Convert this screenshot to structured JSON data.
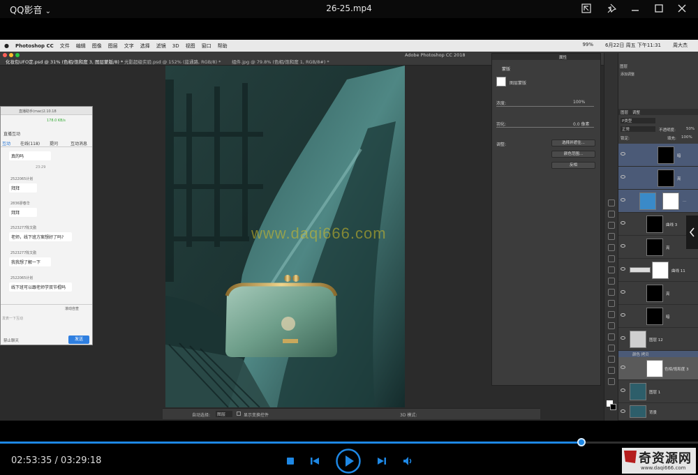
{
  "player": {
    "app_name": "QQ影音",
    "file_title": "26-25.mp4",
    "time_current": "02:53:35",
    "time_separator": " / ",
    "time_total": "03:29:18",
    "progress": 0.833,
    "accent": "#1e88e5"
  },
  "mac_menubar": {
    "items": [
      "Photoshop CC",
      "文件",
      "编辑",
      "图像",
      "图层",
      "文字",
      "选择",
      "滤镜",
      "3D",
      "视图",
      "窗口",
      "帮助"
    ],
    "battery": "99%",
    "date_time": "6月22日 周五 下午11:31",
    "user": "周大杰"
  },
  "ps": {
    "doc_title": "Adobe Photoshop CC 2018",
    "tabs": [
      "化妆包UFO定.psd @ 31% (色相/饱和度 3, 图层蒙版/8) *",
      "光影超级实验.psd @ 152% (蓝通路, RGB/8) *",
      "组件.jpg @ 79.8% (色相/饱和度 1, RGB/8#) *"
    ],
    "watermark": "www.daqi666.com"
  },
  "properties": {
    "tab1": "属性",
    "header": "蒙版",
    "mask_label": "图层蒙版",
    "density_label": "浓度:",
    "density_value": "100%",
    "feather_label": "羽化:",
    "feather_value": "0.0 像素",
    "adjust_label": "调整:",
    "btn_select": "选择并遮住...",
    "btn_color_range": "颜色范围...",
    "btn_invert": "反相"
  },
  "layers": {
    "tabs": [
      "图层",
      "调整"
    ],
    "adjust_tab": "添加调整",
    "kind_label": "P类型",
    "blend_mode": "正常",
    "opacity_label": "不透明度:",
    "opacity_value": "50%",
    "lock_label": "锁定:",
    "fill_label": "填充:",
    "fill_value": "100%",
    "group_name": "颜色 拷贝",
    "rows": [
      {
        "name": "暗",
        "selected": true
      },
      {
        "name": "亮",
        "selected": true
      },
      {
        "name": "…",
        "selected": true
      },
      {
        "name": "曲线 3",
        "selected": false
      },
      {
        "name": "亮",
        "selected": false
      },
      {
        "name": "曲线 11",
        "selected": false
      },
      {
        "name": "亮",
        "selected": false
      },
      {
        "name": "暗",
        "selected": false
      },
      {
        "name": "图层 12",
        "selected": false
      },
      {
        "name": "色相/饱和度 3",
        "selected": false
      },
      {
        "name": "图层 1",
        "selected": false
      },
      {
        "name": "背景",
        "selected": false
      }
    ]
  },
  "options_bar": {
    "auto_select": "自动选择:",
    "layer_select": "图层",
    "show_transform": "显示变换控件",
    "mode_3d": "3D 模式:"
  },
  "chat": {
    "title": "直播助手(mac)2.10.18",
    "signal": "178.0 KB/s",
    "section": "直播互动",
    "tabs": [
      "互动",
      "在线(118)",
      "提问",
      "互动消息"
    ],
    "messages": [
      {
        "name": "",
        "text": "真的吗"
      },
      {
        "name": "2522065计划",
        "text": "拜拜"
      },
      {
        "name": "2836廖春华",
        "text": "拜拜"
      },
      {
        "name": "2523277陈文勤",
        "text": "老师，线下班方案想好了吗?"
      },
      {
        "name": "2523277陈文勤",
        "text": "我我想了解一下"
      },
      {
        "name": "2522065计划",
        "text": "线下班可以跟老师学双节棍吗"
      }
    ],
    "timestamp": "23:29",
    "checkbox": "滚动自查",
    "input_hint": "发表一下互动",
    "mute": "禁止聊天",
    "send": "发送"
  },
  "brand_logo": "奇资源网",
  "brand_url": "www.daqi666.com"
}
